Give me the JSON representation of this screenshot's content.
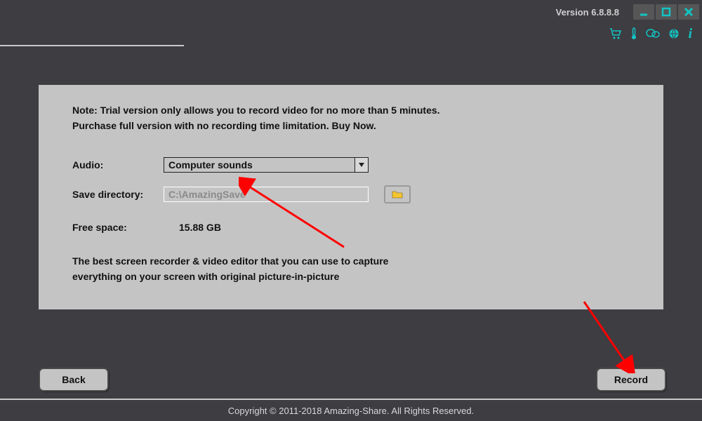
{
  "titlebar": {
    "version_label": "Version 6.8.8.8"
  },
  "panel": {
    "note_line1": "Note: Trial version only allows you to record video for no more than 5 minutes.",
    "note_line2": "Purchase full version with no recording time limitation. Buy Now.",
    "audio_label": "Audio:",
    "audio_value": "Computer sounds",
    "dir_label": "Save directory:",
    "dir_value": "C:\\AmazingSave",
    "space_label": "Free space:",
    "space_value": "15.88 GB",
    "blurb_line1": "The best screen recorder & video editor that you can use to capture",
    "blurb_line2": "everything on your screen with original picture-in-picture"
  },
  "buttons": {
    "back": "Back",
    "record": "Record"
  },
  "footer": {
    "copyright": "Copyright © 2011-2018 Amazing-Share. All Rights Reserved."
  },
  "accent_color": "#13c4c4"
}
